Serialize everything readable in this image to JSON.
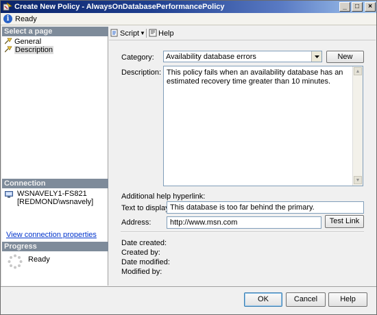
{
  "window": {
    "title": "Create New Policy - AlwaysOnDatabasePerformancePolicy",
    "minimize_label": "_",
    "maximize_label": "□",
    "close_label": "×"
  },
  "status": {
    "text": "Ready",
    "icon": "info-icon"
  },
  "left": {
    "select_page_header": "Select a page",
    "pages": [
      {
        "label": "General",
        "icon": "page-icon",
        "selected": false
      },
      {
        "label": "Description",
        "icon": "page-icon",
        "selected": true
      }
    ],
    "connection_header": "Connection",
    "connection_server": "WSNAVELY1-FS821",
    "connection_user": "[REDMOND\\wsnavely]",
    "view_connection_link": "View connection properties",
    "progress_header": "Progress",
    "progress_status": "Ready"
  },
  "toolbar": {
    "script_label": "Script",
    "help_label": "Help"
  },
  "form": {
    "category_label": "Category:",
    "category_value": "Availability database errors",
    "new_button": "New",
    "description_label": "Description:",
    "description_value": "This policy fails when an availability database has an estimated recovery time greater than 10 minutes.",
    "hyperlink_header": "Additional help hyperlink:",
    "text_to_display_label": "Text to display:",
    "text_to_display_value": "This database is too far behind the primary.",
    "address_label": "Address:",
    "address_value": "http://www.msn.com",
    "test_link_button": "Test Link",
    "date_created_label": "Date created:",
    "created_by_label": "Created by:",
    "date_modified_label": "Date modified:",
    "modified_by_label": "Modified by:"
  },
  "buttons": {
    "ok": "OK",
    "cancel": "Cancel",
    "help": "Help"
  }
}
